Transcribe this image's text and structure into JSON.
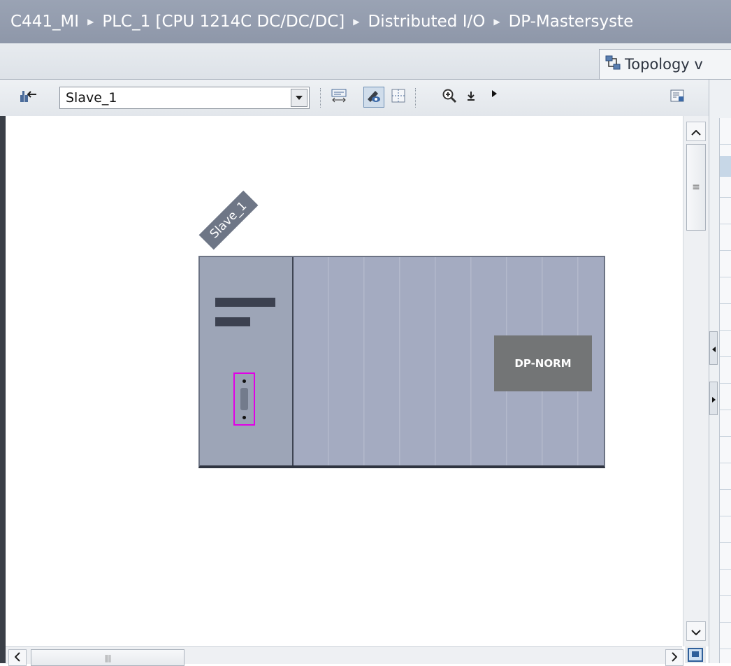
{
  "breadcrumb": {
    "items": [
      "C441_MI",
      "PLC_1 [CPU 1214C DC/DC/DC]",
      "Distributed I/O",
      "DP-Mastersyste"
    ],
    "separator_icon": "triangle-right-icon"
  },
  "tabs": {
    "topology_label": "Topology v",
    "topology_icon": "topology-view-icon"
  },
  "toolbar": {
    "device_select_value": "Slave_1",
    "icons": [
      "network-view-icon",
      "show-module-labels-icon",
      "edit-view-icon",
      "page-break-icon",
      "zoom-in-icon",
      "download-icon",
      "more-icon",
      "properties-panel-icon"
    ]
  },
  "canvas": {
    "device_label": "Slave_1",
    "module_label": "DP-NORM",
    "port_highlight_color": "#e100e6"
  },
  "scrollbars": {
    "v_thumb_grip": "≡",
    "h_thumb_grip": "|||"
  }
}
